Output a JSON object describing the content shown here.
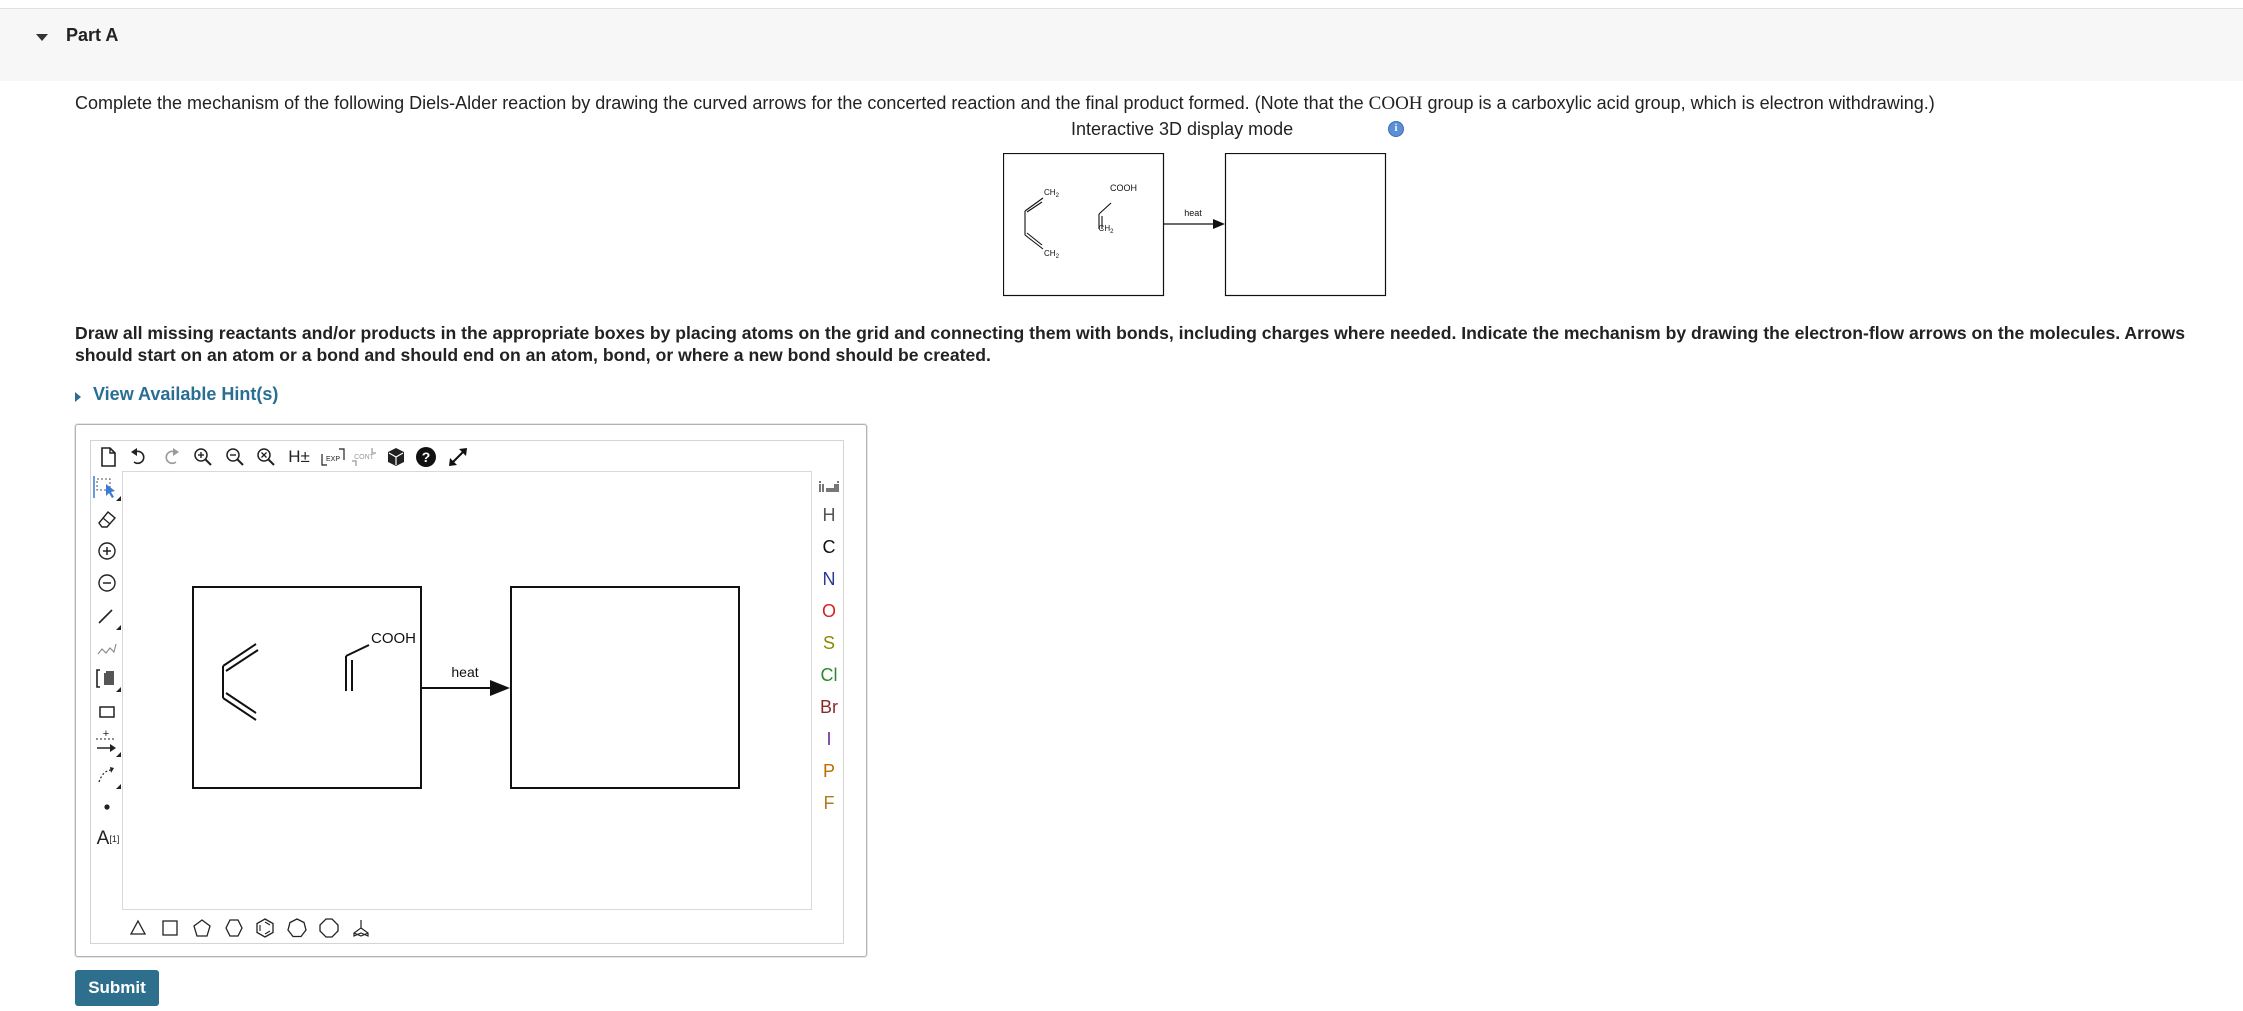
{
  "part": {
    "title": "Part A"
  },
  "question": {
    "text_before": "Complete the mechanism of the following Diels-Alder reaction by drawing the curved arrows for the concerted reaction and the final product formed. (Note that the ",
    "formula": "COOH",
    "text_after": " group is a carboxylic acid group, which is electron withdrawing.)"
  },
  "display_mode": {
    "label": "Interactive 3D display mode",
    "info_icon": "info-icon"
  },
  "scheme": {
    "diene_top": "CH2",
    "diene_bottom": "CH2",
    "dienophile_group": "COOH",
    "dienophile_bottom": "CH2",
    "arrow_label": "heat"
  },
  "draw_instructions": {
    "line1": "Draw all missing reactants and/or products in the appropriate boxes by placing atoms on the grid and connecting them with bonds, including charges where needed.  Indicate the mechanism by drawing the electron-flow arrows on the molecules.  Arrows",
    "line2": "should start on an atom or a bond and should end on an atom, bond, or where a new bond should be created."
  },
  "hints": {
    "label": "View Available Hint(s)"
  },
  "editor": {
    "top_toolbar": [
      "new-document-icon",
      "undo-icon",
      "redo-icon",
      "zoom-in-icon",
      "zoom-out-icon",
      "zoom-reset-icon",
      "hydrogen-toggle-icon",
      "expand-icon",
      "contract-icon",
      "3d-view-icon",
      "help-icon",
      "fullscreen-icon"
    ],
    "h_toggle_text": "H±",
    "exp_text": "EXP",
    "cont_text": "CONT",
    "left_toolbar": [
      "select-icon",
      "eraser-icon",
      "plus-charge-icon",
      "minus-charge-icon",
      "bond-icon",
      "chain-icon",
      "bracket-icon",
      "rectangle-icon",
      "reaction-arrow-icon",
      "curved-arrow-icon",
      "lone-pair-icon",
      "text-icon"
    ],
    "text_tool_label": "A",
    "text_tool_sup": "[1]",
    "periodic_table_icon": "periodic-table-icon",
    "elements": [
      {
        "symbol": "H",
        "color": "#555555"
      },
      {
        "symbol": "C",
        "color": "#111111"
      },
      {
        "symbol": "N",
        "color": "#2b3a9a"
      },
      {
        "symbol": "O",
        "color": "#d62020"
      },
      {
        "symbol": "S",
        "color": "#8a8a00"
      },
      {
        "symbol": "Cl",
        "color": "#2c8a2c"
      },
      {
        "symbol": "Br",
        "color": "#8b2a2a"
      },
      {
        "symbol": "I",
        "color": "#7a2a9a"
      },
      {
        "symbol": "P",
        "color": "#c06a00"
      },
      {
        "symbol": "F",
        "color": "#b07a20"
      }
    ],
    "canvas": {
      "group": "COOH",
      "arrow_label": "heat"
    },
    "bottom_toolbar": [
      "triangle-icon",
      "square-icon",
      "pentagon-icon",
      "hexagon-icon",
      "benzene-icon",
      "heptagon-icon",
      "octagon-icon",
      "chair-icon"
    ]
  },
  "submit": {
    "label": "Submit"
  },
  "colors": {
    "accent": "#2e6f8e",
    "link": "#2a6f93",
    "header_bg": "#f7f7f7"
  }
}
